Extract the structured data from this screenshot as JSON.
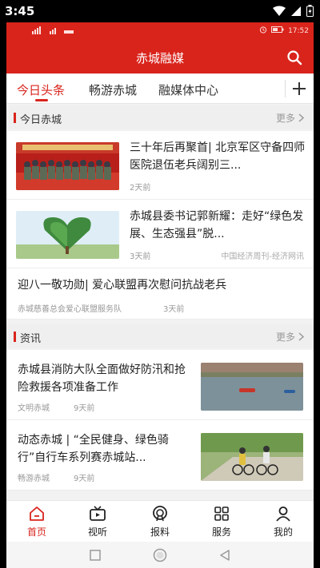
{
  "status": {
    "time": "3:45"
  },
  "inner_status": {
    "time": "17:52"
  },
  "header": {
    "title": "赤城融媒"
  },
  "tabs": [
    {
      "label": "今日头条"
    },
    {
      "label": "畅游赤城"
    },
    {
      "label": "融媒体中心"
    }
  ],
  "section1": {
    "title": "今日赤城",
    "more": "更多"
  },
  "section2": {
    "title": "资讯",
    "more": "更多"
  },
  "articles1": [
    {
      "title": "三十年后再聚首| 北京军区守备四师医院退伍老兵阔别三...",
      "time": "2天前"
    },
    {
      "title": "赤城县委书记郭新耀：走好“绿色发展、生态强县”脱...",
      "time": "3天前",
      "source": "中国经济周刊-经济网讯"
    },
    {
      "title": "迎八一敬功勋| 爱心联盟再次慰问抗战老兵",
      "source": "赤城慈善总会爱心联盟服务队",
      "time": "3天前"
    }
  ],
  "articles2": [
    {
      "title": "赤城县消防大队全面做好防汛和抢险救援各项准备工作",
      "source": "文明赤城",
      "time": "9天前"
    },
    {
      "title": "动态赤城 | “全民健身、绿色骑行”自行车系列赛赤城站...",
      "source": "畅游赤城",
      "time": "9天前"
    }
  ],
  "tabbar": [
    {
      "label": "首页",
      "icon": "home-icon"
    },
    {
      "label": "视听",
      "icon": "video-icon"
    },
    {
      "label": "报料",
      "icon": "broadcast-icon"
    },
    {
      "label": "服务",
      "icon": "grid-icon"
    },
    {
      "label": "我的",
      "icon": "user-icon"
    }
  ],
  "colors": {
    "brand": "#d9241c",
    "background": "#f2f2f2"
  }
}
